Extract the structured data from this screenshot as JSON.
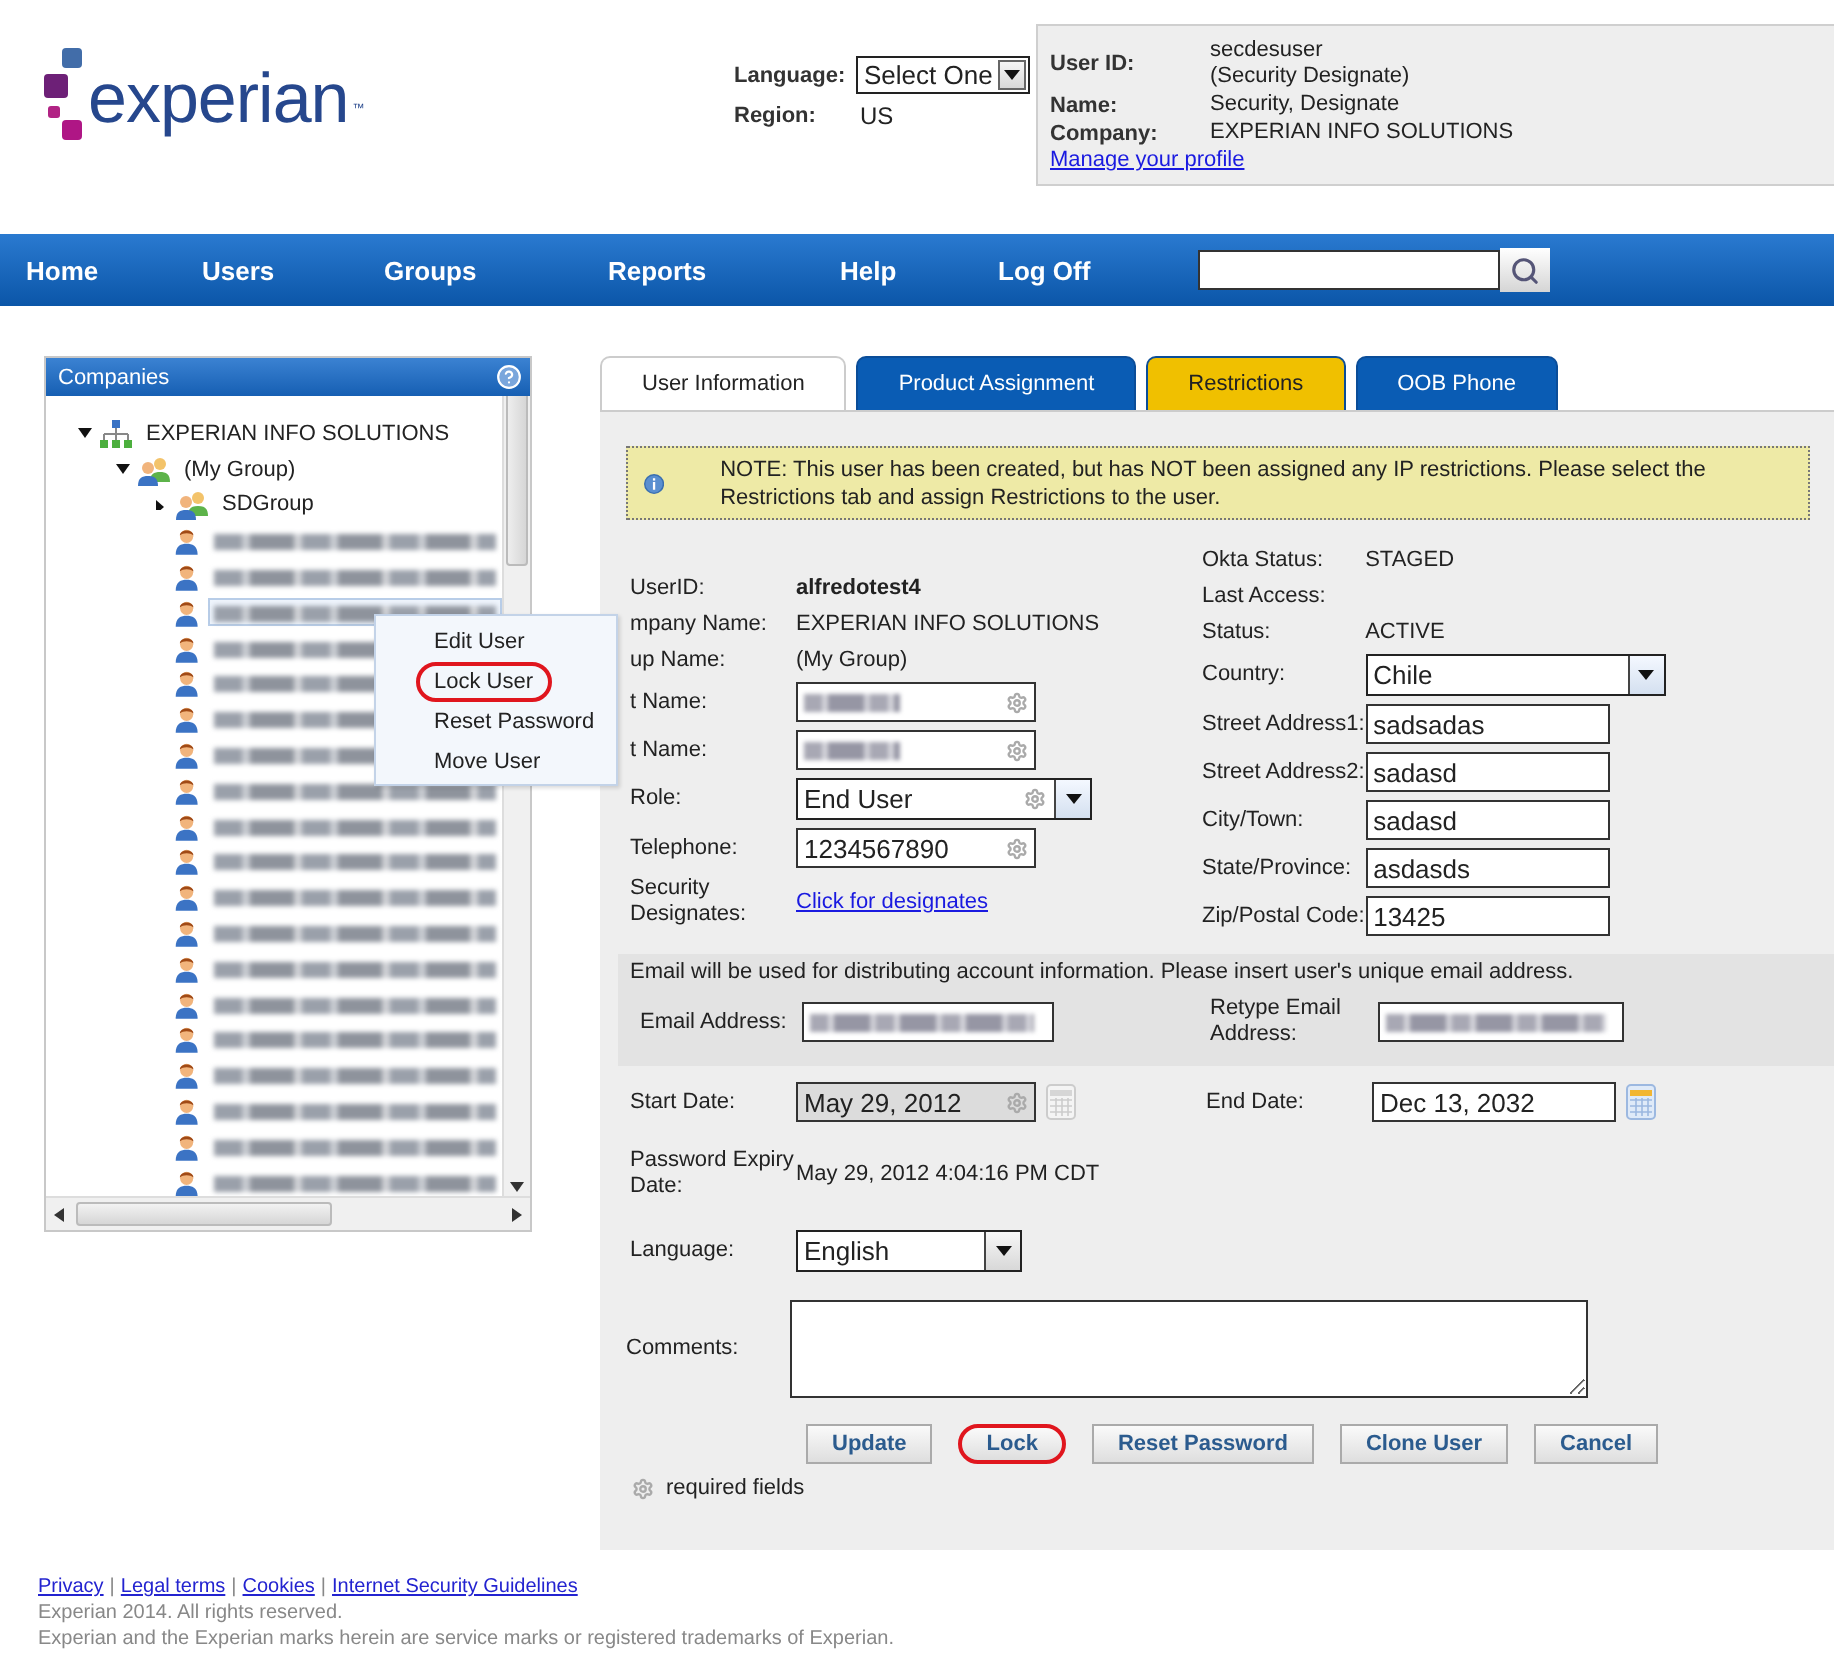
{
  "header": {
    "logo": "experian",
    "logo_tm": "™",
    "language_label": "Language:",
    "language_value": "Select One",
    "region_label": "Region:",
    "region_value": "US"
  },
  "profile": {
    "user_id_label": "User ID:",
    "user_id": "secdesuser",
    "user_role": "(Security Designate)",
    "name_label": "Name:",
    "name": "Security, Designate",
    "company_label": "Company:",
    "company": "EXPERIAN INFO SOLUTIONS",
    "link": "Manage your profile"
  },
  "nav": {
    "items": [
      "Home",
      "Users",
      "Groups",
      "Reports",
      "Help",
      "Log Off"
    ]
  },
  "companies": {
    "title": "Companies",
    "tree": [
      {
        "kind": "company",
        "label": "EXPERIAN INFO SOLUTIONS",
        "expanded": true,
        "selected": false,
        "children": [
          {
            "kind": "group",
            "label": "(My Group)",
            "expanded": true,
            "selected": false,
            "children": [
              {
                "kind": "group",
                "label": "SDGroup",
                "expanded": false,
                "selected": false
              },
              {
                "kind": "user",
                "selected": false
              },
              {
                "kind": "user",
                "selected": false
              },
              {
                "kind": "user",
                "selected": true
              },
              {
                "kind": "user",
                "selected": false
              },
              {
                "kind": "user",
                "selected": false
              },
              {
                "kind": "user",
                "selected": false
              },
              {
                "kind": "user",
                "selected": false
              },
              {
                "kind": "user",
                "selected": false
              },
              {
                "kind": "user",
                "selected": false
              },
              {
                "kind": "user",
                "selected": false
              },
              {
                "kind": "user",
                "selected": false
              },
              {
                "kind": "user",
                "selected": false
              },
              {
                "kind": "user",
                "selected": false
              },
              {
                "kind": "user",
                "selected": false
              },
              {
                "kind": "user",
                "selected": false
              },
              {
                "kind": "user",
                "selected": false
              },
              {
                "kind": "user",
                "selected": false
              },
              {
                "kind": "user",
                "selected": false
              },
              {
                "kind": "user",
                "selected": false
              }
            ]
          }
        ]
      }
    ]
  },
  "context_menu": {
    "items": [
      {
        "label": "Edit User",
        "highlighted": false
      },
      {
        "label": "Lock User",
        "highlighted": true
      },
      {
        "label": "Reset Password",
        "highlighted": false
      },
      {
        "label": "Move User",
        "highlighted": false
      }
    ]
  },
  "tabs": [
    {
      "label": "User Information",
      "selected": true,
      "color": "#ffffff"
    },
    {
      "label": "Product Assignment",
      "selected": false,
      "color": "#0a5cb4"
    },
    {
      "label": "Restrictions",
      "selected": false,
      "color": "#f0c000"
    },
    {
      "label": "OOB Phone",
      "selected": false,
      "color": "#0a5cb4"
    }
  ],
  "note": "NOTE: This user has been created, but has NOT been assigned any IP restrictions. Please select the Restrictions tab and assign Restrictions to the user.",
  "form": {
    "left": [
      {
        "label": "UserID:",
        "kind": "bold",
        "value": "alfredotest4",
        "required": false
      },
      {
        "label": "mpany Name:",
        "kind": "static",
        "value": "EXPERIAN INFO SOLUTIONS",
        "required": false
      },
      {
        "label": "up Name:",
        "kind": "static",
        "value": "(My Group)",
        "required": false
      },
      {
        "label": "t Name:",
        "kind": "redacted",
        "required": true
      },
      {
        "label": "t Name:",
        "kind": "redacted",
        "required": true
      },
      {
        "label": "Role:",
        "kind": "select",
        "value": "End User",
        "required": true
      },
      {
        "label": "Telephone:",
        "kind": "input",
        "value": "1234567890",
        "required": true
      },
      {
        "label": "Security Designates:",
        "kind": "link",
        "value": "Click for designates",
        "required": false
      }
    ],
    "right": [
      {
        "label": "Okta Status:",
        "kind": "static",
        "value": "STAGED",
        "required": false
      },
      {
        "label": "Last Access:",
        "kind": "static",
        "required": false
      },
      {
        "label": "Status:",
        "kind": "static",
        "value": "ACTIVE",
        "required": false
      },
      {
        "label": "Country:",
        "kind": "select",
        "value": "Chile",
        "required": false
      },
      {
        "label": "Street Address1:",
        "kind": "input",
        "value": "sadsadas",
        "required": false
      },
      {
        "label": "Street Address2:",
        "kind": "input",
        "value": "sadasd",
        "required": false
      },
      {
        "label": "City/Town:",
        "kind": "input",
        "value": "sadasd",
        "required": false
      },
      {
        "label": "State/Province:",
        "kind": "input",
        "value": "asdasds",
        "required": false
      },
      {
        "label": "Zip/Postal Code:",
        "kind": "input",
        "value": "13425",
        "required": false
      }
    ]
  },
  "email": {
    "note": "Email will be used for distributing account information. Please insert user's unique email address.",
    "address_label": "Email Address:",
    "retype_label": "Retype Email Address:"
  },
  "dates": [
    {
      "label": "Start Date:",
      "value": "May 29, 2012",
      "disabled": true,
      "required": true
    },
    {
      "label": "End Date:",
      "value": "Dec 13, 2032",
      "disabled": false,
      "required": false
    }
  ],
  "password_expiry": {
    "label": "Password Expiry Date:",
    "value": "May 29, 2012 4:04:16 PM CDT"
  },
  "language": {
    "label": "Language:",
    "value": "English"
  },
  "comments": {
    "label": "Comments:"
  },
  "buttons": [
    {
      "label": "Update",
      "highlighted": false
    },
    {
      "label": "Lock",
      "highlighted": true
    },
    {
      "label": "Reset Password",
      "highlighted": false
    },
    {
      "label": "Clone User",
      "highlighted": false
    },
    {
      "label": "Cancel",
      "highlighted": false
    }
  ],
  "required_note": "required fields",
  "footer": {
    "links": [
      "Privacy",
      "Legal terms",
      "Cookies",
      "Internet Security Guidelines"
    ],
    "separators": [
      "|",
      "|",
      "|"
    ],
    "lines": [
      "Experian 2014. All rights reserved.",
      "Experian and the Experian marks herein are service marks or registered trademarks of Experian."
    ]
  }
}
